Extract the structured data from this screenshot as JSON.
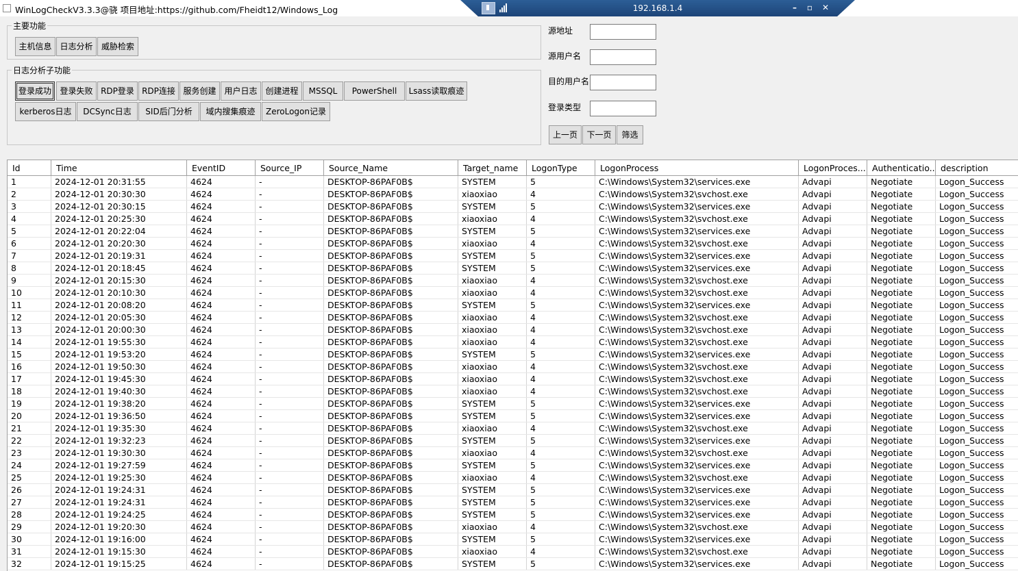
{
  "window": {
    "title": "WinLogCheckV3.3.3@骁 项目地址:https://github.com/Fheidt12/Windows_Log"
  },
  "remote_bar": {
    "ip": "192.168.1.4",
    "minimize": "–",
    "restore": "▫",
    "close": "✕"
  },
  "main_group": {
    "title": "主要功能",
    "buttons": [
      "主机信息",
      "日志分析",
      "威胁检索"
    ]
  },
  "sub_group": {
    "title": "日志分析子功能",
    "row1": [
      "登录成功",
      "登录失败",
      "RDP登录",
      "RDP连接",
      "服务创建",
      "用户日志",
      "创建进程",
      "MSSQL",
      "PowerShell",
      "Lsass读取痕迹"
    ],
    "row2": [
      "kerberos日志",
      "DCSync日志",
      "SID后门分析",
      "域内搜集痕迹",
      "ZeroLogon记录"
    ],
    "active": "登录成功"
  },
  "filter": {
    "source_ip_label": "源地址",
    "source_ip_value": "",
    "source_user_label": "源用户名",
    "source_user_value": "",
    "target_user_label": "目的用户名",
    "target_user_value": "",
    "logon_type_label": "登录类型",
    "logon_type_value": "",
    "prev_label": "上一页",
    "next_label": "下一页",
    "filter_label": "筛选"
  },
  "table": {
    "columns": [
      "Id",
      "Time",
      "EventID",
      "Source_IP",
      "Source_Name",
      "Target_name",
      "LogonType",
      "LogonProcess",
      "LogonProces...",
      "Authenticatio...",
      "description"
    ],
    "rows": [
      [
        "1",
        "2024-12-01 20:31:55",
        "4624",
        "-",
        "DESKTOP-86PAF0B$",
        "SYSTEM",
        "5",
        "C:\\Windows\\System32\\services.exe",
        "Advapi",
        "Negotiate",
        "Logon_Success"
      ],
      [
        "2",
        "2024-12-01 20:30:30",
        "4624",
        "-",
        "DESKTOP-86PAF0B$",
        "xiaoxiao",
        "4",
        "C:\\Windows\\System32\\svchost.exe",
        "Advapi",
        "Negotiate",
        "Logon_Success"
      ],
      [
        "3",
        "2024-12-01 20:30:15",
        "4624",
        "-",
        "DESKTOP-86PAF0B$",
        "SYSTEM",
        "5",
        "C:\\Windows\\System32\\services.exe",
        "Advapi",
        "Negotiate",
        "Logon_Success"
      ],
      [
        "4",
        "2024-12-01 20:25:30",
        "4624",
        "-",
        "DESKTOP-86PAF0B$",
        "xiaoxiao",
        "4",
        "C:\\Windows\\System32\\svchost.exe",
        "Advapi",
        "Negotiate",
        "Logon_Success"
      ],
      [
        "5",
        "2024-12-01 20:22:04",
        "4624",
        "-",
        "DESKTOP-86PAF0B$",
        "SYSTEM",
        "5",
        "C:\\Windows\\System32\\services.exe",
        "Advapi",
        "Negotiate",
        "Logon_Success"
      ],
      [
        "6",
        "2024-12-01 20:20:30",
        "4624",
        "-",
        "DESKTOP-86PAF0B$",
        "xiaoxiao",
        "4",
        "C:\\Windows\\System32\\svchost.exe",
        "Advapi",
        "Negotiate",
        "Logon_Success"
      ],
      [
        "7",
        "2024-12-01 20:19:31",
        "4624",
        "-",
        "DESKTOP-86PAF0B$",
        "SYSTEM",
        "5",
        "C:\\Windows\\System32\\services.exe",
        "Advapi",
        "Negotiate",
        "Logon_Success"
      ],
      [
        "8",
        "2024-12-01 20:18:45",
        "4624",
        "-",
        "DESKTOP-86PAF0B$",
        "SYSTEM",
        "5",
        "C:\\Windows\\System32\\services.exe",
        "Advapi",
        "Negotiate",
        "Logon_Success"
      ],
      [
        "9",
        "2024-12-01 20:15:30",
        "4624",
        "-",
        "DESKTOP-86PAF0B$",
        "xiaoxiao",
        "4",
        "C:\\Windows\\System32\\svchost.exe",
        "Advapi",
        "Negotiate",
        "Logon_Success"
      ],
      [
        "10",
        "2024-12-01 20:10:30",
        "4624",
        "-",
        "DESKTOP-86PAF0B$",
        "xiaoxiao",
        "4",
        "C:\\Windows\\System32\\svchost.exe",
        "Advapi",
        "Negotiate",
        "Logon_Success"
      ],
      [
        "11",
        "2024-12-01 20:08:20",
        "4624",
        "-",
        "DESKTOP-86PAF0B$",
        "SYSTEM",
        "5",
        "C:\\Windows\\System32\\services.exe",
        "Advapi",
        "Negotiate",
        "Logon_Success"
      ],
      [
        "12",
        "2024-12-01 20:05:30",
        "4624",
        "-",
        "DESKTOP-86PAF0B$",
        "xiaoxiao",
        "4",
        "C:\\Windows\\System32\\svchost.exe",
        "Advapi",
        "Negotiate",
        "Logon_Success"
      ],
      [
        "13",
        "2024-12-01 20:00:30",
        "4624",
        "-",
        "DESKTOP-86PAF0B$",
        "xiaoxiao",
        "4",
        "C:\\Windows\\System32\\svchost.exe",
        "Advapi",
        "Negotiate",
        "Logon_Success"
      ],
      [
        "14",
        "2024-12-01 19:55:30",
        "4624",
        "-",
        "DESKTOP-86PAF0B$",
        "xiaoxiao",
        "4",
        "C:\\Windows\\System32\\svchost.exe",
        "Advapi",
        "Negotiate",
        "Logon_Success"
      ],
      [
        "15",
        "2024-12-01 19:53:20",
        "4624",
        "-",
        "DESKTOP-86PAF0B$",
        "SYSTEM",
        "5",
        "C:\\Windows\\System32\\services.exe",
        "Advapi",
        "Negotiate",
        "Logon_Success"
      ],
      [
        "16",
        "2024-12-01 19:50:30",
        "4624",
        "-",
        "DESKTOP-86PAF0B$",
        "xiaoxiao",
        "4",
        "C:\\Windows\\System32\\svchost.exe",
        "Advapi",
        "Negotiate",
        "Logon_Success"
      ],
      [
        "17",
        "2024-12-01 19:45:30",
        "4624",
        "-",
        "DESKTOP-86PAF0B$",
        "xiaoxiao",
        "4",
        "C:\\Windows\\System32\\svchost.exe",
        "Advapi",
        "Negotiate",
        "Logon_Success"
      ],
      [
        "18",
        "2024-12-01 19:40:30",
        "4624",
        "-",
        "DESKTOP-86PAF0B$",
        "xiaoxiao",
        "4",
        "C:\\Windows\\System32\\svchost.exe",
        "Advapi",
        "Negotiate",
        "Logon_Success"
      ],
      [
        "19",
        "2024-12-01 19:38:20",
        "4624",
        "-",
        "DESKTOP-86PAF0B$",
        "SYSTEM",
        "5",
        "C:\\Windows\\System32\\services.exe",
        "Advapi",
        "Negotiate",
        "Logon_Success"
      ],
      [
        "20",
        "2024-12-01 19:36:50",
        "4624",
        "-",
        "DESKTOP-86PAF0B$",
        "SYSTEM",
        "5",
        "C:\\Windows\\System32\\services.exe",
        "Advapi",
        "Negotiate",
        "Logon_Success"
      ],
      [
        "21",
        "2024-12-01 19:35:30",
        "4624",
        "-",
        "DESKTOP-86PAF0B$",
        "xiaoxiao",
        "4",
        "C:\\Windows\\System32\\svchost.exe",
        "Advapi",
        "Negotiate",
        "Logon_Success"
      ],
      [
        "22",
        "2024-12-01 19:32:23",
        "4624",
        "-",
        "DESKTOP-86PAF0B$",
        "SYSTEM",
        "5",
        "C:\\Windows\\System32\\services.exe",
        "Advapi",
        "Negotiate",
        "Logon_Success"
      ],
      [
        "23",
        "2024-12-01 19:30:30",
        "4624",
        "-",
        "DESKTOP-86PAF0B$",
        "xiaoxiao",
        "4",
        "C:\\Windows\\System32\\svchost.exe",
        "Advapi",
        "Negotiate",
        "Logon_Success"
      ],
      [
        "24",
        "2024-12-01 19:27:59",
        "4624",
        "-",
        "DESKTOP-86PAF0B$",
        "SYSTEM",
        "5",
        "C:\\Windows\\System32\\services.exe",
        "Advapi",
        "Negotiate",
        "Logon_Success"
      ],
      [
        "25",
        "2024-12-01 19:25:30",
        "4624",
        "-",
        "DESKTOP-86PAF0B$",
        "xiaoxiao",
        "4",
        "C:\\Windows\\System32\\svchost.exe",
        "Advapi",
        "Negotiate",
        "Logon_Success"
      ],
      [
        "26",
        "2024-12-01 19:24:31",
        "4624",
        "-",
        "DESKTOP-86PAF0B$",
        "SYSTEM",
        "5",
        "C:\\Windows\\System32\\services.exe",
        "Advapi",
        "Negotiate",
        "Logon_Success"
      ],
      [
        "27",
        "2024-12-01 19:24:31",
        "4624",
        "-",
        "DESKTOP-86PAF0B$",
        "SYSTEM",
        "5",
        "C:\\Windows\\System32\\services.exe",
        "Advapi",
        "Negotiate",
        "Logon_Success"
      ],
      [
        "28",
        "2024-12-01 19:24:25",
        "4624",
        "-",
        "DESKTOP-86PAF0B$",
        "SYSTEM",
        "5",
        "C:\\Windows\\System32\\services.exe",
        "Advapi",
        "Negotiate",
        "Logon_Success"
      ],
      [
        "29",
        "2024-12-01 19:20:30",
        "4624",
        "-",
        "DESKTOP-86PAF0B$",
        "xiaoxiao",
        "4",
        "C:\\Windows\\System32\\svchost.exe",
        "Advapi",
        "Negotiate",
        "Logon_Success"
      ],
      [
        "30",
        "2024-12-01 19:16:00",
        "4624",
        "-",
        "DESKTOP-86PAF0B$",
        "SYSTEM",
        "5",
        "C:\\Windows\\System32\\services.exe",
        "Advapi",
        "Negotiate",
        "Logon_Success"
      ],
      [
        "31",
        "2024-12-01 19:15:30",
        "4624",
        "-",
        "DESKTOP-86PAF0B$",
        "xiaoxiao",
        "4",
        "C:\\Windows\\System32\\svchost.exe",
        "Advapi",
        "Negotiate",
        "Logon_Success"
      ],
      [
        "32",
        "2024-12-01 19:15:25",
        "4624",
        "-",
        "DESKTOP-86PAF0B$",
        "SYSTEM",
        "5",
        "C:\\Windows\\System32\\services.exe",
        "Advapi",
        "Negotiate",
        "Logon_Success"
      ]
    ]
  }
}
